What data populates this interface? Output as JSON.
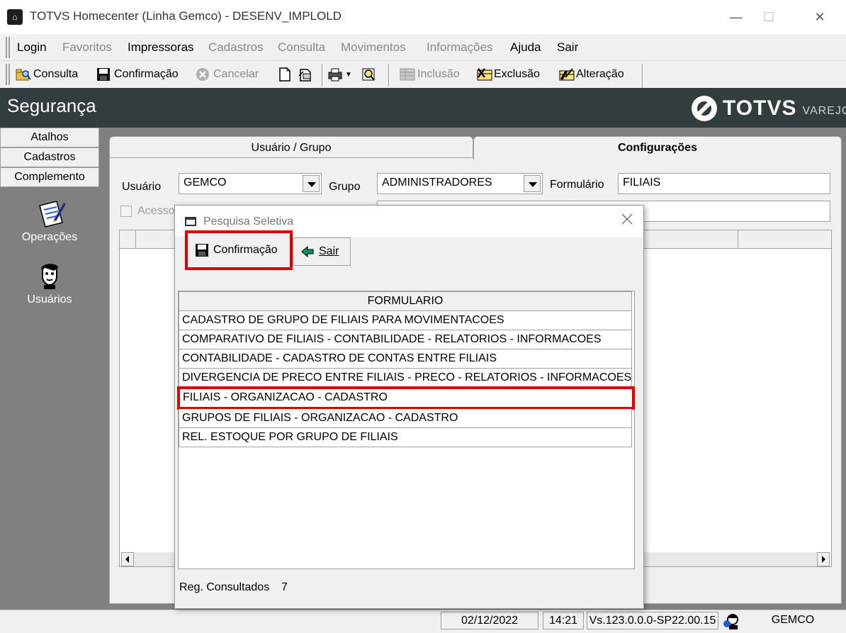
{
  "window": {
    "title": "TOTVS Homecenter (Linha Gemco) - DESENV_IMPLOLD",
    "minimize": "—",
    "maximize": "☐",
    "close": "✕"
  },
  "menu": {
    "items": [
      {
        "label": "Login",
        "enabled": true
      },
      {
        "label": "Favoritos",
        "enabled": false
      },
      {
        "label": "Impressoras",
        "enabled": true
      },
      {
        "label": "Cadastros",
        "enabled": false
      },
      {
        "label": "Consulta",
        "enabled": false
      },
      {
        "label": "Movimentos",
        "enabled": false
      },
      {
        "label": "Informações",
        "enabled": false
      },
      {
        "label": "Ajuda",
        "enabled": true
      },
      {
        "label": "Sair",
        "enabled": true
      }
    ]
  },
  "toolbar": {
    "consulta": "Consulta",
    "confirmacao": "Confirmação",
    "cancelar": "Cancelar",
    "inclusao": "Inclusão",
    "exclusao": "Exclusão",
    "alteracao": "Alteração"
  },
  "header": {
    "title": "Segurança",
    "logo_text": "TOTVS",
    "logo_sub": "VAREJO"
  },
  "leftnav": {
    "buttons": [
      "Atalhos",
      "Cadastros",
      "Complemento"
    ],
    "shortcuts": [
      {
        "label": "Operações",
        "icon": "operations-icon"
      },
      {
        "label": "Usuários",
        "icon": "users-icon"
      }
    ]
  },
  "tabs": {
    "tab1": "Usuário  / Grupo",
    "tab2": "Configurações"
  },
  "form": {
    "usuario_label": "Usuário",
    "usuario_value": "GEMCO",
    "grupo_label": "Grupo",
    "grupo_value": "ADMINISTRADORES",
    "formulario_label": "Formulário",
    "formulario_value": "FILIAIS",
    "acesso_label": "Acesso"
  },
  "dialog": {
    "title": "Pesquisa Seletiva",
    "confirm_button": "Confirmação",
    "exit_button": "Sair",
    "column_header": "FORMULARIO",
    "rows": [
      "CADASTRO DE GRUPO DE FILIAIS PARA MOVIMENTACOES",
      "COMPARATIVO DE FILIAIS - CONTABILIDADE - RELATORIOS - INFORMACOES",
      "CONTABILIDADE - CADASTRO DE CONTAS ENTRE FILIAIS",
      "DIVERGENCIA DE PRECO ENTRE FILIAIS - PRECO - RELATORIOS - INFORMACOES",
      "FILIAIS - ORGANIZACAO - CADASTRO",
      "GRUPOS DE FILIAIS - ORGANIZACAO - CADASTRO",
      "REL. ESTOQUE POR GRUPO DE FILIAIS"
    ],
    "selected_row": 4,
    "reg_label": "Reg. Consultados",
    "reg_value": "7"
  },
  "status": {
    "date": "02/12/2022",
    "time": "14:21",
    "version": "Vs.123.0.0.0-SP22.00.15",
    "user": "GEMCO"
  },
  "colors": {
    "header_bg": "#333c3e",
    "highlight": "#e00000",
    "workspace_bg": "#808080"
  }
}
